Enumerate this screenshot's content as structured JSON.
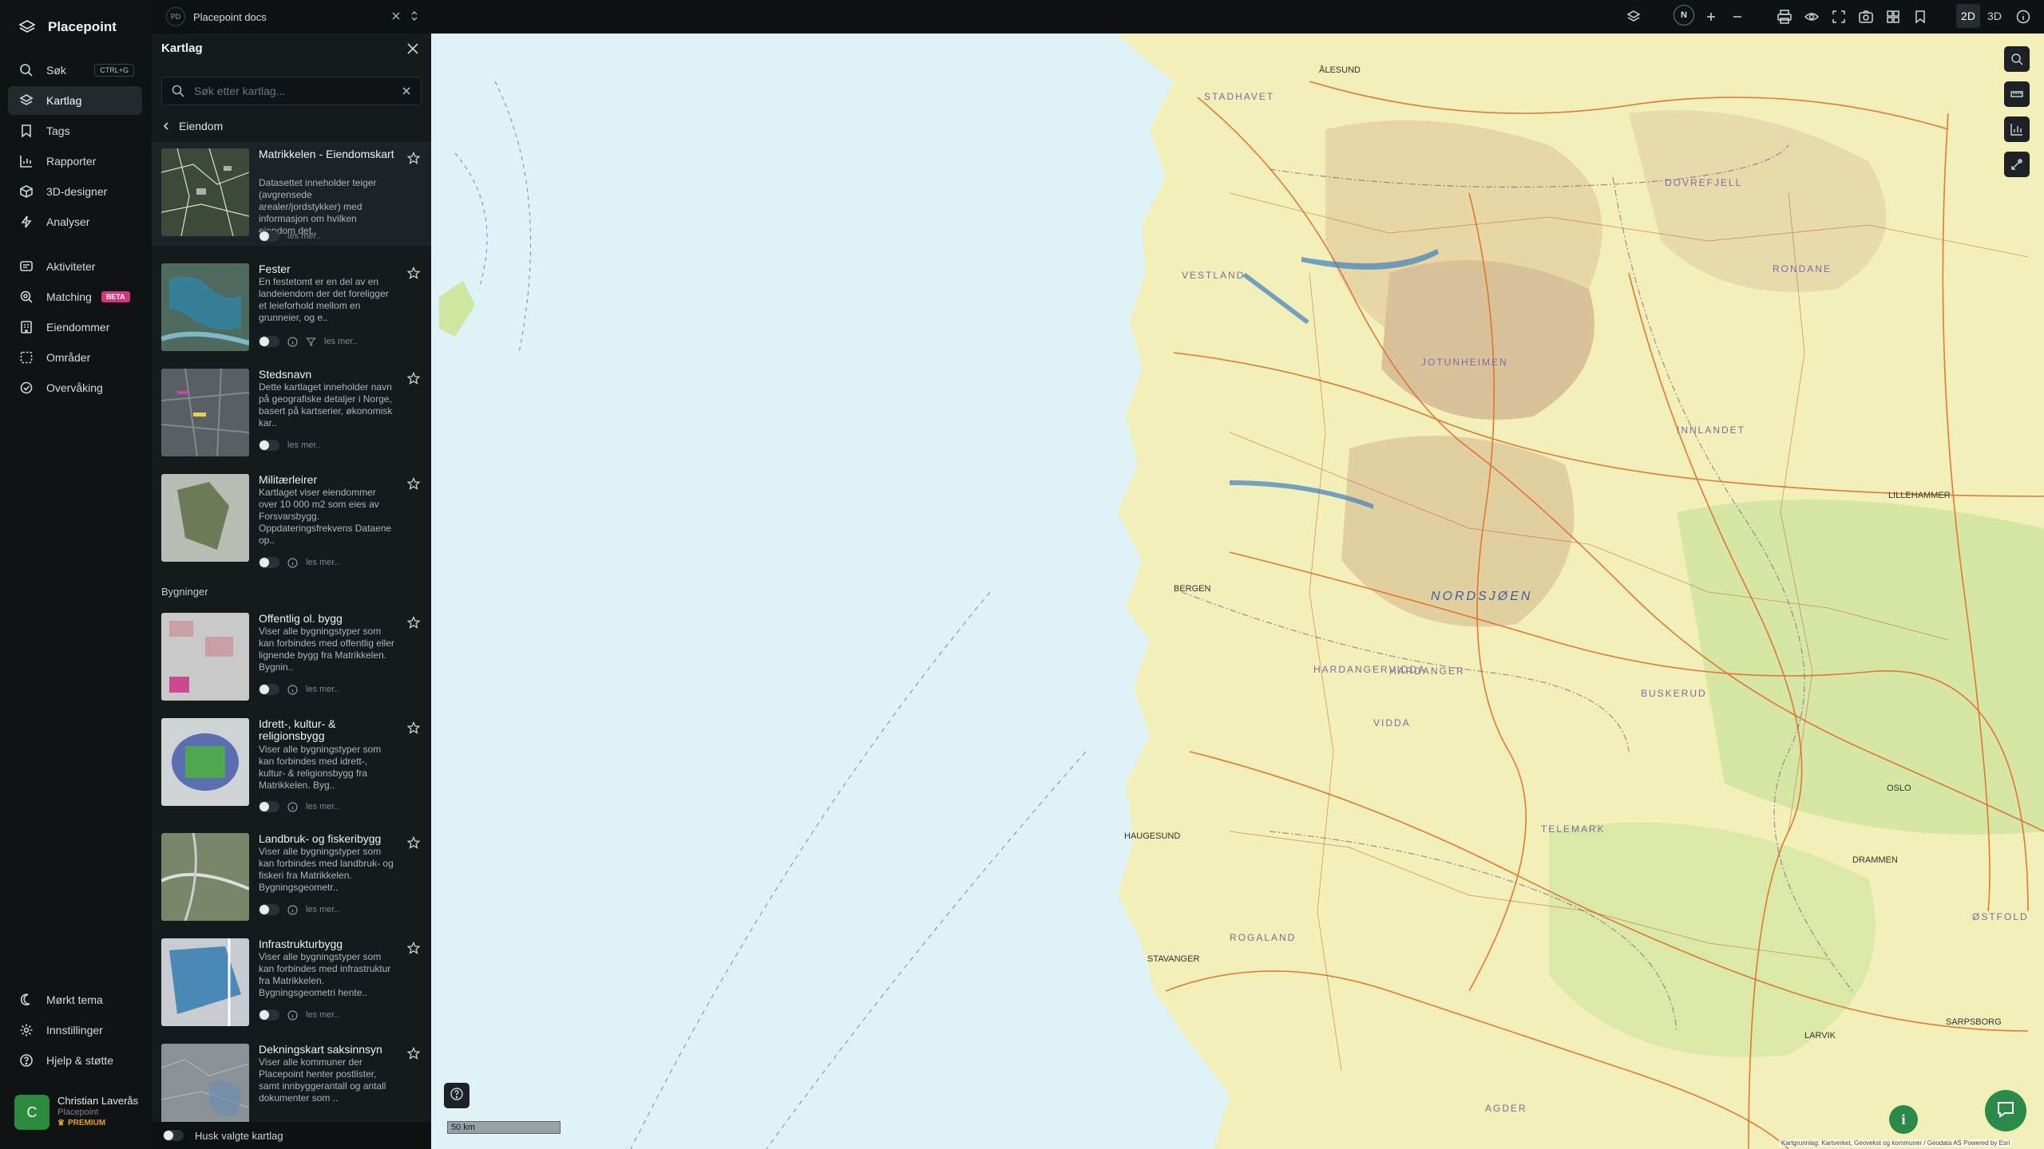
{
  "app": {
    "name": "Placepoint"
  },
  "nav": {
    "items": [
      {
        "label": "Søk",
        "shortcut": "CTRL+G",
        "icon": "search-icon"
      },
      {
        "label": "Kartlag",
        "icon": "layers-icon",
        "active": true
      },
      {
        "label": "Tags",
        "icon": "bookmark-icon"
      },
      {
        "label": "Rapporter",
        "icon": "chart-icon"
      },
      {
        "label": "3D-designer",
        "icon": "cube-icon"
      },
      {
        "label": "Analyser",
        "icon": "bolt-icon"
      },
      {
        "label": "Aktiviteter",
        "icon": "activity-icon"
      },
      {
        "label": "Matching",
        "badge": "BETA",
        "icon": "target-icon"
      },
      {
        "label": "Eiendommer",
        "icon": "building-icon"
      },
      {
        "label": "Områder",
        "icon": "area-icon"
      },
      {
        "label": "Overvåking",
        "icon": "monitor-icon"
      }
    ],
    "bottom": [
      {
        "label": "Mørkt tema",
        "icon": "moon-icon"
      },
      {
        "label": "Innstillinger",
        "icon": "gear-icon"
      },
      {
        "label": "Hjelp & støtte",
        "icon": "help-icon"
      }
    ]
  },
  "user": {
    "initial": "C",
    "name": "Christian Laverås",
    "org": "Placepoint",
    "plan": "PREMIUM"
  },
  "tab": {
    "badge": "PD",
    "title": "Placepoint docs"
  },
  "panel": {
    "title": "Kartlag",
    "search_placeholder": "Søk etter kartlag...",
    "breadcrumb": "Eiendom",
    "section_buildings": "Bygninger",
    "read_more": "les mer..",
    "remember": "Husk valgte kartlag",
    "layers": [
      {
        "title": "Matrikkelen - Eiendomskart",
        "desc": "Datasettet inneholder teiger (avgrensede arealer/jordstykker) med informasjon om hvilken eiendom det.."
      },
      {
        "title": "Fester",
        "desc": "En festetomt er en del av en landeiendom der det foreligger et leieforhold mellom en grunneier, og e.."
      },
      {
        "title": "Stedsnavn",
        "desc": "Dette kartlaget inneholder navn på geografiske detaljer i Norge, basert på kartserier, økonomisk kar.."
      },
      {
        "title": "Militærleirer",
        "desc": "Kartlaget viser eiendommer over 10 000 m2 som eies av Forsvarsbygg. Oppdateringsfrekvens Dataene op.."
      },
      {
        "title": "Offentlig ol. bygg",
        "desc": "Viser alle bygningstyper som kan forbindes med offentlig eller lignende bygg fra Matrikkelen. Bygnin.."
      },
      {
        "title": "Idrett-, kultur- & religionsbygg",
        "desc": "Viser alle bygningstyper som kan forbindes med idrett-, kultur- & religionsbygg fra Matrikkelen. Byg.."
      },
      {
        "title": "Landbruk- og fiskeribygg",
        "desc": "Viser alle bygningstyper som kan forbindes med landbruk- og fiskeri fra Matrikkelen. Bygningsgeometr.."
      },
      {
        "title": "Infrastrukturbygg",
        "desc": "Viser alle bygningstyper som kan forbindes med infrastruktur fra Matrikkelen. Bygningsgeometri hente.."
      },
      {
        "title": "Dekningskart saksinnsyn",
        "desc": "Viser alle kommuner der Placepoint henter postlister, samt innbyggerantall og antall dokumenter som .."
      }
    ]
  },
  "map": {
    "view_2d": "2D",
    "view_3d": "3D",
    "compass": "N",
    "scale": "50 km",
    "sea": "NORDSJØEN",
    "attribution": "Kartgrunnlag: Kartverket, Geovekst og kommuner / Geodata AS Powered by Esri",
    "places": [
      "ÅLESUND",
      "STADHAVET",
      "BERGEN",
      "STAVANGER",
      "HAUGESUND",
      "LILLEHAMMER",
      "OSLO",
      "DRAMMEN",
      "JOTUNHEIMEN",
      "HARDANGERVIDDA",
      "VESTLAND",
      "ROGALAND",
      "TELEMARK",
      "BUSKERUD",
      "INNLANDET",
      "AGDER",
      "DOVREFJELL",
      "RONDANE",
      "VIDDA",
      "HARDANGER",
      "SARPSBORG",
      "LARVIK",
      "ØSTFOLD"
    ],
    "colors": {
      "sea": "#dff3f7",
      "land": "#f3efb8",
      "mountain": "#d9c29a",
      "road": "#e06d24",
      "border": "#8a5a8a"
    }
  }
}
